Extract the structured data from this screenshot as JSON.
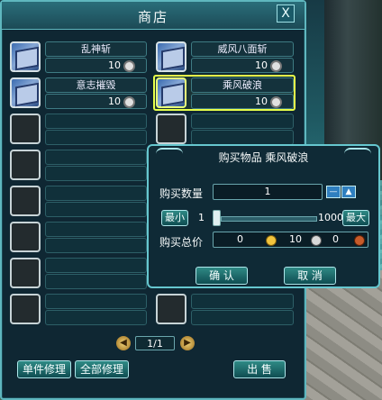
{
  "shop": {
    "title": "商店",
    "close_label": "X",
    "items": [
      {
        "name": "乱神斩",
        "price": "10"
      },
      {
        "name": "威风八面斩",
        "price": "10"
      },
      {
        "name": "意志摧毁",
        "price": "10"
      },
      {
        "name": "乘风破浪",
        "price": "10"
      }
    ],
    "pager": "1/1",
    "buttons": {
      "repair_single": "单件修理",
      "repair_all": "全部修理",
      "sell": "出 售"
    }
  },
  "purchase_dialog": {
    "title": "购买物品 乘风破浪",
    "qty_label": "购买数量",
    "qty_value": "1",
    "min_label": "最小",
    "max_label": "最大",
    "slider_min": "1",
    "slider_max": "1000",
    "slider_fraction": 0.0,
    "total_label": "购买总价",
    "total_gold": "0",
    "total_silver": "10",
    "total_copper": "0",
    "confirm_label": "确 认",
    "cancel_label": "取 消"
  },
  "colors": {
    "accent": "#5fb7bf",
    "selection": "#e6ff4a",
    "button": "#2f8a85",
    "step_button": "#2f7fbf",
    "gold": "#f2c43d",
    "silver": "#d8d8d8",
    "copper": "#c75b2a"
  },
  "icons": {
    "item": "skill-book-icon",
    "close": "close-icon",
    "prev": "page-prev-icon",
    "next": "page-next-icon",
    "coin": "silver-coin-icon",
    "minus": "minus-icon",
    "plus": "plus-icon"
  }
}
